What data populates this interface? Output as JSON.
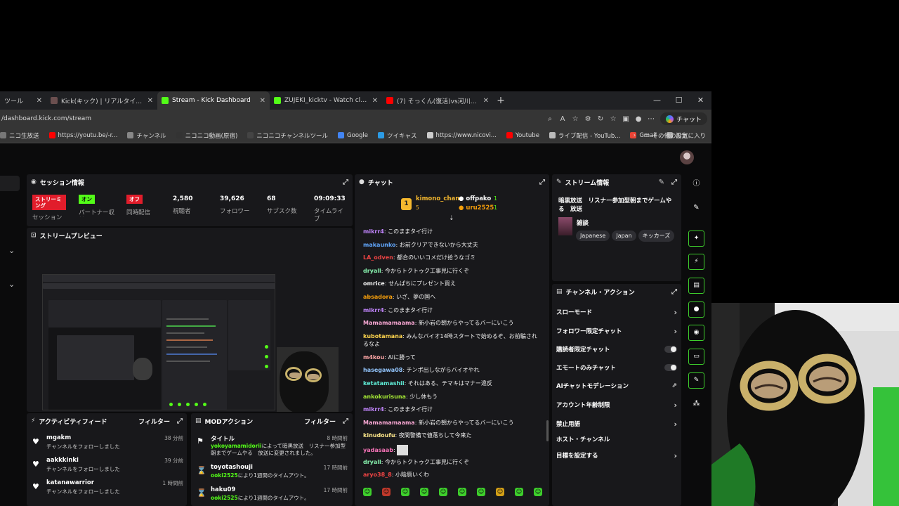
{
  "browser": {
    "tabs": [
      {
        "label": "ツール",
        "color": "#555555"
      },
      {
        "label": "Kick(キック) | リアルタイムランキング",
        "color": "#6b4f4f"
      },
      {
        "label": "Stream - Kick Dashboard",
        "color": "#53fc18"
      },
      {
        "label": "ZUJEKI_kicktv - Watch clips on Kick",
        "color": "#53fc18"
      },
      {
        "label": "(7) そっくん(復活)vs河川敷の謎の中国",
        "color": "#ff0000"
      }
    ],
    "url": "/dashboard.kick.com/stream",
    "chat_button": "チャット",
    "bookmarks": [
      {
        "label": "ニコ生放送",
        "color": "#777777"
      },
      {
        "label": "https://youtu.be/-r...",
        "color": "#ff0000"
      },
      {
        "label": "チャンネル",
        "color": "#888888"
      },
      {
        "label": "ニコニコ動画(原宿)",
        "color": "#333333"
      },
      {
        "label": "ニコニコチャンネルツール",
        "color": "#444444"
      },
      {
        "label": "Google",
        "color": "#4285f4"
      },
      {
        "label": "ツイキャス",
        "color": "#2c9be5"
      },
      {
        "label": "https://www.nicovi...",
        "color": "#cccccc"
      },
      {
        "label": "Youtube",
        "color": "#ff0000"
      },
      {
        "label": "ライブ配信 - YouTub...",
        "color": "#bbbbbb"
      },
      {
        "label": "Gmail",
        "color": "#ea4335"
      },
      {
        "label": "設定",
        "color": "#aaaaaa"
      }
    ],
    "other_bookmarks": "その他のお気に入り"
  },
  "session": {
    "title": "セッション情報",
    "stream_status_badge": "ストリーミング",
    "stream_status_label": "セッション",
    "partner_badge": "オン",
    "partner_label": "パートナー収益",
    "simulcast_badge": "オフ",
    "simulcast_label": "同時配信",
    "viewers": "2,580",
    "viewers_label": "視聴者",
    "followers": "39,626",
    "followers_label": "フォロワー",
    "subs": "68",
    "subs_label": "サブスク数",
    "uptime": "09:09:33",
    "uptime_label": "タイムライブ"
  },
  "preview": {
    "title": "ストリームプレビュー"
  },
  "chat": {
    "title": "チャット",
    "top_gifters": [
      {
        "name": "kimono_chan",
        "count": "5"
      },
      {
        "name": "offpako",
        "count": "1"
      },
      {
        "name": "uru2525",
        "count": "1"
      }
    ],
    "messages": [
      {
        "user": "mikrr4",
        "text": "このままタイ行け",
        "color": "#c084fc"
      },
      {
        "user": "makaunko",
        "text": "お前クリアできないから大丈夫",
        "color": "#60a5fa"
      },
      {
        "user": "LA_odven",
        "text": "都合のいいコメだけ拾うなゴミ",
        "color": "#ef4444"
      },
      {
        "user": "dryall",
        "text": "今からトクトゥク工事見に行くぞ",
        "color": "#86efac"
      },
      {
        "user": "omrice",
        "text": "せんぱちにプレゼント買え",
        "color": "#f5f5f5"
      },
      {
        "user": "absadora",
        "text": "いざ、夢の国へ",
        "color": "#f59e0b"
      },
      {
        "user": "mikrr4",
        "text": "このままタイ行け",
        "color": "#c084fc"
      },
      {
        "user": "Mamamamaama",
        "text": "新小岩の朝からやってるバーにいこう",
        "color": "#f9a8d4"
      },
      {
        "user": "kubotamana",
        "text": "みんなバイオ14時スタートで始めるぞ、お前騙されるなよ",
        "color": "#fcd34d"
      },
      {
        "user": "m4kou",
        "text": "AIに勝って",
        "color": "#fca5a5"
      },
      {
        "user": "hasegawa08",
        "text": "チンポ出しながらバイオやれ",
        "color": "#93c5fd"
      },
      {
        "user": "ketatamashii",
        "text": "それはある、テマキはマナー違反",
        "color": "#5eead4"
      },
      {
        "user": "ankokurisuna",
        "text": "少し休もう",
        "color": "#a3e635"
      },
      {
        "user": "mikrr4",
        "text": "このままタイ行け",
        "color": "#c084fc"
      },
      {
        "user": "Mamamamaama",
        "text": "新小岩の朝からやってるバーにいこう",
        "color": "#f9a8d4"
      },
      {
        "user": "kinudoufu",
        "text": "夜間警備で値落ちして今来た",
        "color": "#fde68a"
      },
      {
        "user": "yadasaab",
        "text": "",
        "color": "#f472b6"
      },
      {
        "user": "dryall",
        "text": "今からトクトゥク工事見に行くぞ",
        "color": "#86efac"
      },
      {
        "user": "aryo38_8",
        "text": "小陰唇いくわ",
        "color": "#ef4444"
      }
    ]
  },
  "stream_info": {
    "title": "ストリーム情報",
    "stream_title": "暗黒放送　リスナー参加型朝までゲームやる　放送",
    "category": "雑談",
    "tags": [
      "Japanese",
      "Japan",
      "キッカーズ"
    ]
  },
  "channel_actions": {
    "title": "チャンネル・アクション",
    "items": [
      {
        "label": "スローモード",
        "control": "chevron"
      },
      {
        "label": "フォロワー限定チャット",
        "control": "chevron"
      },
      {
        "label": "購読者限定チャット",
        "control": "toggle"
      },
      {
        "label": "エモートのみチャット",
        "control": "toggle"
      },
      {
        "label": "AIチャットモデレーション",
        "control": "external"
      },
      {
        "label": "アカウント年齢制限",
        "control": "chevron"
      },
      {
        "label": "禁止用語",
        "control": "chevron"
      },
      {
        "label": "ホスト・チャンネル",
        "control": "none"
      },
      {
        "label": "目標を設定する",
        "control": "chevron"
      }
    ]
  },
  "activity": {
    "title": "アクティビティフィード",
    "filter": "フィルター",
    "items": [
      {
        "name": "mgakm",
        "desc": "チャンネルをフォローしました",
        "time": "38 分前"
      },
      {
        "name": "aakkkinki",
        "desc": "チャンネルをフォローしました",
        "time": "39 分前"
      },
      {
        "name": "katanawarrior",
        "desc": "チャンネルをフォローしました",
        "time": "1 時間前"
      }
    ]
  },
  "mod_actions": {
    "title": "MODアクション",
    "filter": "フィルター",
    "items": [
      {
        "title": "タイトル",
        "user": "yokoyamamidorii",
        "desc": "によって暗黒放送　リスナー参加型朝までゲームやる　放送に変更されました。",
        "time": "8 時間前"
      },
      {
        "title": "toyotashouji",
        "user": "ooki2525",
        "desc": "により1週間のタイムアウト。",
        "time": "17 時間前"
      },
      {
        "title": "haku09",
        "user": "ooki2525",
        "desc": "により1週間のタイムアウト。",
        "time": "17 時間前"
      }
    ]
  }
}
